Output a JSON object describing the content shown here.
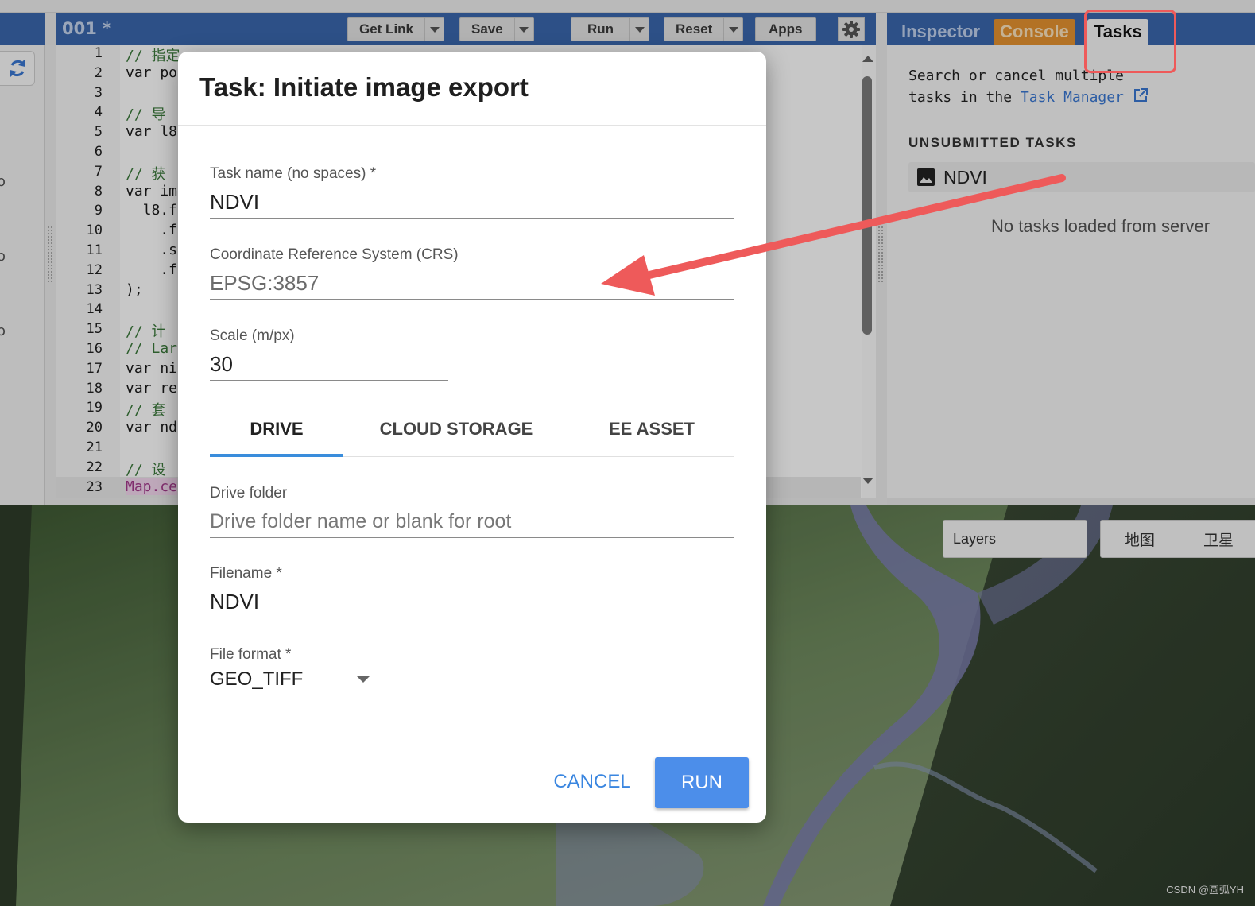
{
  "editor": {
    "file_title": "001 *",
    "toolbar": {
      "get_link": "Get Link",
      "save": "Save",
      "run": "Run",
      "reset": "Reset",
      "apps": "Apps"
    },
    "line_numbers": [
      "1",
      "2",
      "3",
      "4",
      "5",
      "6",
      "7",
      "8",
      "9",
      "10",
      "11",
      "12",
      "13",
      "14",
      "15",
      "16",
      "17",
      "18",
      "19",
      "20",
      "21",
      "22",
      "23"
    ],
    "code_lines": [
      {
        "n": 1,
        "text": "// 指定",
        "cls": "cm"
      },
      {
        "n": 2,
        "text": "var po",
        "cls": ""
      },
      {
        "n": 4,
        "text": "// 导",
        "cls": "cm"
      },
      {
        "n": 5,
        "text": "var l8",
        "cls": ""
      },
      {
        "n": 7,
        "text": "// 获",
        "cls": "cm"
      },
      {
        "n": 8,
        "text": "var im",
        "cls": ""
      },
      {
        "n": 9,
        "text": "  l8.f",
        "cls": ""
      },
      {
        "n": 10,
        "text": "    .f",
        "cls": ""
      },
      {
        "n": 11,
        "text": "    .s",
        "cls": ""
      },
      {
        "n": 12,
        "text": "    .f",
        "cls": ""
      },
      {
        "n": 13,
        "text": ");",
        "cls": ""
      },
      {
        "n": 15,
        "text": "// 计",
        "cls": "cm"
      },
      {
        "n": 16,
        "text": "// Lar",
        "cls": "cm"
      },
      {
        "n": 17,
        "text": "var ni",
        "cls": ""
      },
      {
        "n": 18,
        "text": "var re",
        "cls": ""
      },
      {
        "n": 19,
        "text": "// 套",
        "cls": "cm"
      },
      {
        "n": 20,
        "text": "var nd",
        "cls": ""
      },
      {
        "n": 22,
        "text": "// 设",
        "cls": "cm"
      },
      {
        "n": 23,
        "text": "Map.ce",
        "cls": "hl"
      }
    ]
  },
  "panel": {
    "tabs": {
      "inspector": "Inspector",
      "console": "Console",
      "tasks": "Tasks"
    },
    "desc_line1": "Search or cancel multiple",
    "desc_prefix": "tasks in the ",
    "desc_link": "Task Manager",
    "unsubmitted_heading": "UNSUBMITTED TASKS",
    "task_name": "NDVI",
    "no_tasks": "No tasks loaded from server"
  },
  "map": {
    "layers_label": "Layers",
    "map_type_map": "地图",
    "map_type_satellite": "卫星",
    "watermark": "CSDN @圆弧YH"
  },
  "dialog": {
    "title": "Task: Initiate image export",
    "task_name_label": "Task name (no spaces) *",
    "task_name_value": "NDVI",
    "crs_label": "Coordinate Reference System (CRS)",
    "crs_value": "EPSG:3857",
    "scale_label": "Scale (m/px)",
    "scale_value": "30",
    "tabs": {
      "drive": "DRIVE",
      "cloud": "CLOUD STORAGE",
      "asset": "EE ASSET"
    },
    "drive_folder_label": "Drive folder",
    "drive_folder_placeholder": "Drive folder name or blank for root",
    "filename_label": "Filename *",
    "filename_value": "NDVI",
    "file_format_label": "File format *",
    "file_format_value": "GEO_TIFF",
    "cancel": "CANCEL",
    "run": "RUN"
  },
  "colors": {
    "header_blue": "#3a67ad",
    "console_orange": "#e69330",
    "link_blue": "#3a78d3",
    "primary_button": "#4c8eea",
    "tab_indicator": "#3a8ddc",
    "annotation_red": "#ee5a5a"
  }
}
